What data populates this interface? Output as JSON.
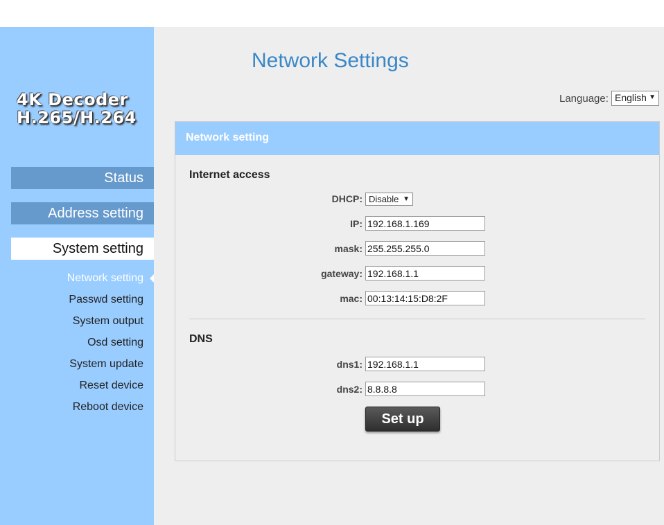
{
  "brand": {
    "line1": "4K Decoder",
    "line2": "H.265/H.264"
  },
  "nav": {
    "main": [
      {
        "label": "Status",
        "active": false
      },
      {
        "label": "Address setting",
        "active": false
      },
      {
        "label": "System setting",
        "active": true
      }
    ],
    "sub": [
      {
        "label": "Network setting",
        "active": true
      },
      {
        "label": "Passwd setting",
        "active": false
      },
      {
        "label": "System output",
        "active": false
      },
      {
        "label": "Osd setting",
        "active": false
      },
      {
        "label": "System update",
        "active": false
      },
      {
        "label": "Reset device",
        "active": false
      },
      {
        "label": "Reboot device",
        "active": false
      }
    ]
  },
  "page": {
    "title": "Network Settings"
  },
  "language": {
    "label": "Language:",
    "value": "English"
  },
  "panel": {
    "header": "Network setting",
    "internet": {
      "title": "Internet access",
      "dhcp_label": "DHCP:",
      "dhcp_value": "Disable",
      "ip_label": "IP:",
      "ip_value": "192.168.1.169",
      "mask_label": "mask:",
      "mask_value": "255.255.255.0",
      "gateway_label": "gateway:",
      "gateway_value": "192.168.1.1",
      "mac_label": "mac:",
      "mac_value": "00:13:14:15:D8:2F"
    },
    "dns": {
      "title": "DNS",
      "dns1_label": "dns1:",
      "dns1_value": "192.168.1.1",
      "dns2_label": "dns2:",
      "dns2_value": "8.8.8.8"
    },
    "submit_label": "Set up"
  },
  "colors": {
    "sidebar_bg": "#99ccff",
    "nav_item_bg": "#6699cc",
    "title_color": "#3a87c8",
    "panel_header_bg": "#99ccff",
    "content_bg": "#eeeeee"
  },
  "icons": {
    "select_arrow": "dropdown-arrow-icon",
    "active_marker": "caret-left-icon"
  }
}
